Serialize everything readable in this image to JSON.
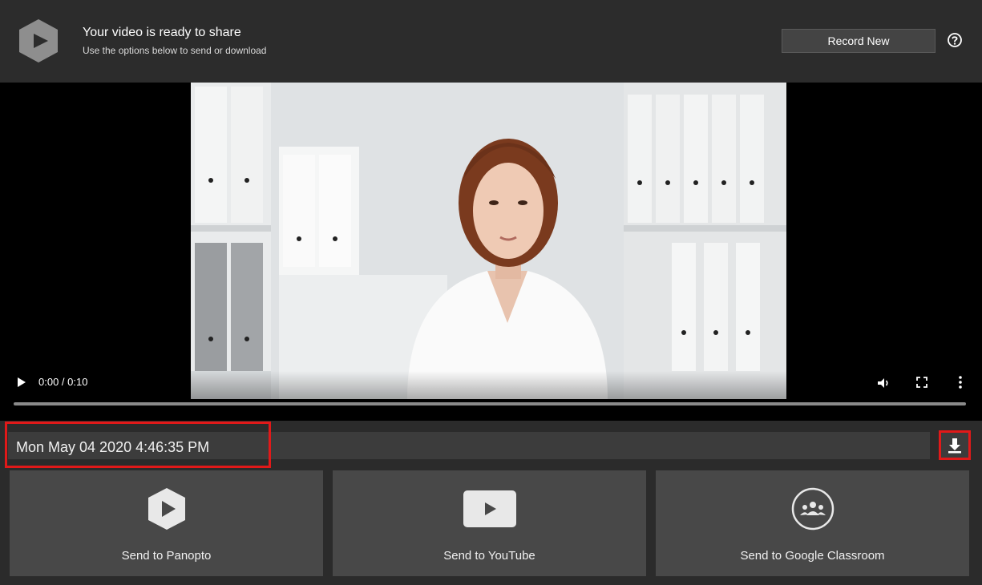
{
  "header": {
    "title": "Your video is ready to share",
    "subtitle": "Use the options below to send or download",
    "record_new_label": "Record New",
    "help_icon": "help-circle-icon",
    "logo_icon": "panopto-logo-icon"
  },
  "player": {
    "time": "0:00 / 0:10",
    "progress": 0,
    "icons": [
      "play-icon",
      "volume-icon",
      "fullscreen-icon",
      "more-vertical-icon"
    ]
  },
  "recording": {
    "name": "Mon May 04 2020 4:46:35 PM",
    "download_icon": "download-icon"
  },
  "share": {
    "items": [
      {
        "label": "Send to Panopto",
        "icon": "panopto-icon"
      },
      {
        "label": "Send to YouTube",
        "icon": "youtube-icon"
      },
      {
        "label": "Send to Google Classroom",
        "icon": "google-classroom-icon"
      }
    ]
  },
  "colors": {
    "background": "#2b2b2b",
    "tile": "#484848",
    "highlight": "#e11919"
  }
}
